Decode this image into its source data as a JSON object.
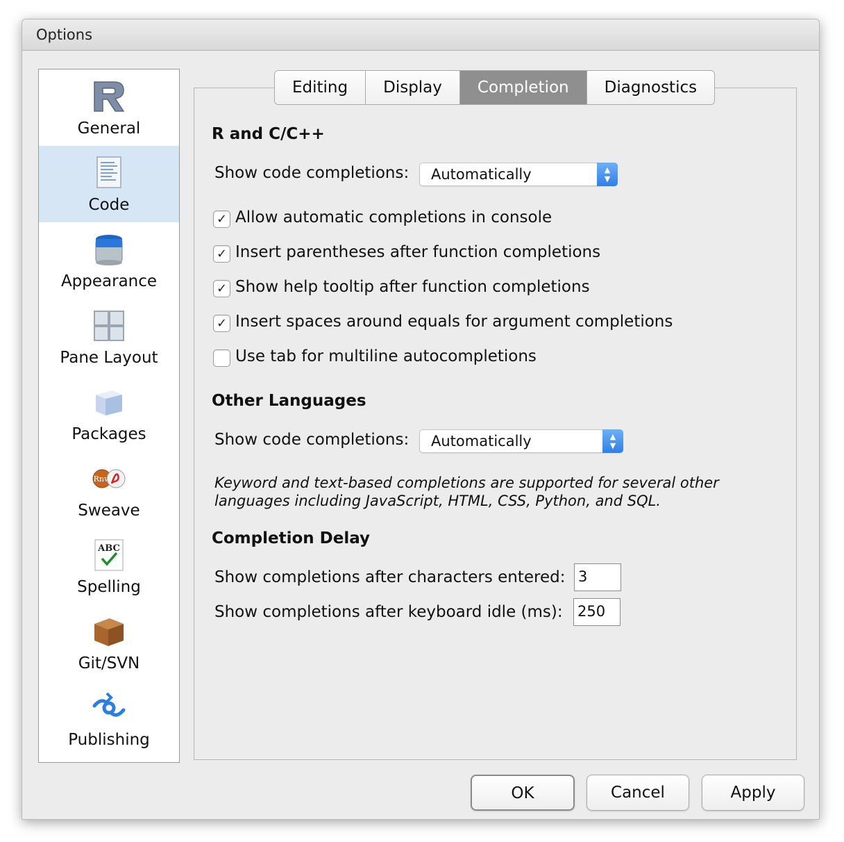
{
  "window": {
    "title": "Options"
  },
  "sidebar": {
    "items": [
      {
        "label": "General",
        "icon": "r-logo-icon"
      },
      {
        "label": "Code",
        "icon": "code-document-icon",
        "selected": true
      },
      {
        "label": "Appearance",
        "icon": "paint-bucket-icon"
      },
      {
        "label": "Pane Layout",
        "icon": "pane-grid-icon"
      },
      {
        "label": "Packages",
        "icon": "package-cube-icon"
      },
      {
        "label": "Sweave",
        "icon": "sweave-icon"
      },
      {
        "label": "Spelling",
        "icon": "spelling-abc-icon"
      },
      {
        "label": "Git/SVN",
        "icon": "git-box-icon"
      },
      {
        "label": "Publishing",
        "icon": "publishing-icon"
      }
    ]
  },
  "tabs": [
    {
      "label": "Editing"
    },
    {
      "label": "Display"
    },
    {
      "label": "Completion",
      "active": true
    },
    {
      "label": "Diagnostics"
    }
  ],
  "r_section": {
    "title": "R and C/C++",
    "show_label": "Show code completions:",
    "show_value": "Automatically",
    "options": [
      {
        "label": "Allow automatic completions in console",
        "checked": true
      },
      {
        "label": "Insert parentheses after function completions",
        "checked": true
      },
      {
        "label": "Show help tooltip after function completions",
        "checked": true
      },
      {
        "label": "Insert spaces around equals for argument completions",
        "checked": true
      },
      {
        "label": "Use tab for multiline autocompletions",
        "checked": false
      }
    ]
  },
  "other_section": {
    "title": "Other Languages",
    "show_label": "Show code completions:",
    "show_value": "Automatically",
    "note": "Keyword and text-based completions are supported for several other languages including JavaScript, HTML, CSS, Python, and SQL."
  },
  "delay_section": {
    "title": "Completion Delay",
    "chars_label": "Show completions after characters entered:",
    "chars_value": "3",
    "idle_label": "Show completions after keyboard idle (ms):",
    "idle_value": "250"
  },
  "buttons": {
    "ok": "OK",
    "cancel": "Cancel",
    "apply": "Apply"
  },
  "colors": {
    "accent": "#2f7fe6",
    "selected_bg": "#d7e6f4",
    "active_tab": "#8f8f8f"
  }
}
